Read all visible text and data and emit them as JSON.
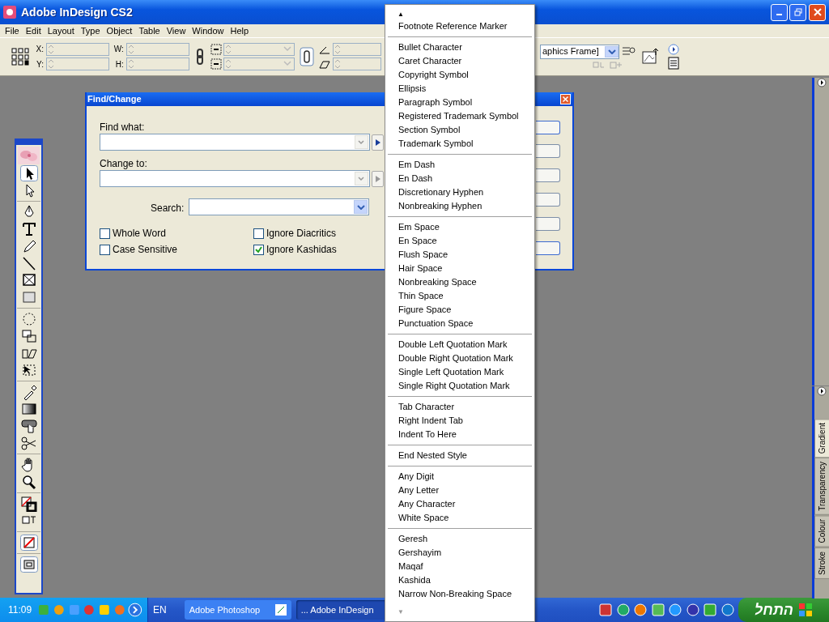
{
  "window": {
    "title": "Adobe InDesign CS2"
  },
  "menu_bar": [
    "File",
    "Edit",
    "Layout",
    "Type",
    "Object",
    "Table",
    "View",
    "Window",
    "Help"
  ],
  "control_panel": {
    "labels": [
      "X:",
      "Y:",
      "W:",
      "H:"
    ],
    "object_style": "aphics Frame]"
  },
  "find_change": {
    "title": "Find/Change",
    "find_label": "Find what:",
    "change_label": "Change to:",
    "search_label": "Search:",
    "options": [
      {
        "label": "Whole Word",
        "checked": false
      },
      {
        "label": "Ignore Diacritics",
        "checked": false
      },
      {
        "label": "Case Sensitive",
        "checked": false
      },
      {
        "label": "Ignore Kashidas",
        "checked": true
      }
    ]
  },
  "special_menu": {
    "scroll_up": "▲",
    "scroll_down": "▼",
    "groups": [
      [
        "Footnote Reference Marker"
      ],
      [
        "Bullet Character",
        "Caret Character",
        "Copyright Symbol",
        "Ellipsis",
        "Paragraph Symbol",
        "Registered Trademark Symbol",
        "Section Symbol",
        "Trademark Symbol"
      ],
      [
        "Em Dash",
        "En Dash",
        "Discretionary Hyphen",
        "Nonbreaking Hyphen"
      ],
      [
        "Em Space",
        "En Space",
        "Flush Space",
        "Hair Space",
        "Nonbreaking Space",
        "Thin Space",
        "Figure Space",
        "Punctuation Space"
      ],
      [
        "Double Left Quotation Mark",
        "Double Right Quotation Mark",
        "Single Left Quotation Mark",
        "Single Right Quotation Mark"
      ],
      [
        "Tab Character",
        "Right Indent Tab",
        "Indent To Here"
      ],
      [
        "End Nested Style"
      ],
      [
        "Any Digit",
        "Any Letter",
        "Any Character",
        "White Space"
      ],
      [
        "Geresh",
        "Gershayim",
        "Maqaf",
        "Kashida",
        "Narrow Non-Breaking Space"
      ]
    ]
  },
  "panel_tabs": [
    {
      "label": "Gradient",
      "selected": true
    },
    {
      "label": "Transparency",
      "selected": false
    },
    {
      "label": "Colour",
      "selected": false
    },
    {
      "label": "Stroke",
      "selected": false
    }
  ],
  "taskbar": {
    "clock": "11:09",
    "language": "EN",
    "tasks": [
      {
        "label": "Adobe Photoshop",
        "selected": false
      },
      {
        "label": "... Adobe InDesign",
        "selected": true
      }
    ],
    "start": "התחל"
  }
}
